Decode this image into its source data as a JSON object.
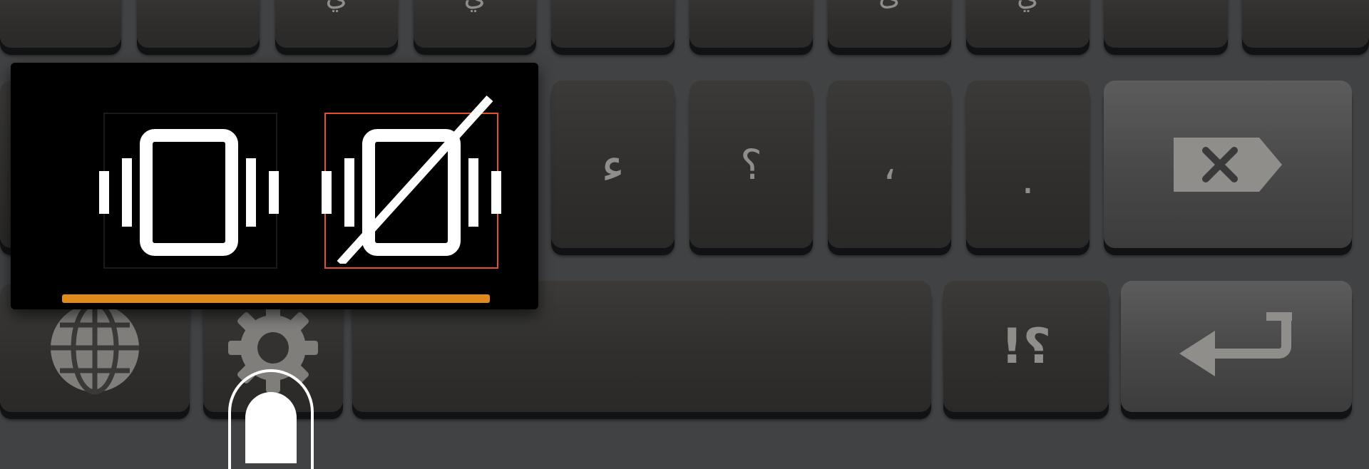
{
  "keyboard": {
    "top_row_glyphs": [
      "",
      "",
      "ي",
      "ي",
      "",
      "",
      "ئ",
      "ي",
      "",
      ""
    ],
    "mid_row_glyphs": [
      "ء",
      "؟",
      "،",
      "."
    ],
    "symbols_key_label": "!؟",
    "space_label": ""
  },
  "vibrate_popup": {
    "options": [
      {
        "name": "vibrate-on",
        "icon": "vibrate-icon",
        "selected": false
      },
      {
        "name": "vibrate-off",
        "icon": "vibrate-off-icon",
        "selected": true
      }
    ],
    "indicator_color": "#e08a1e",
    "selected_border_color": "#e0502a"
  },
  "icons": {
    "language": "globe-icon",
    "settings": "gear-icon",
    "backspace": "backspace-icon",
    "enter": "enter-icon"
  }
}
